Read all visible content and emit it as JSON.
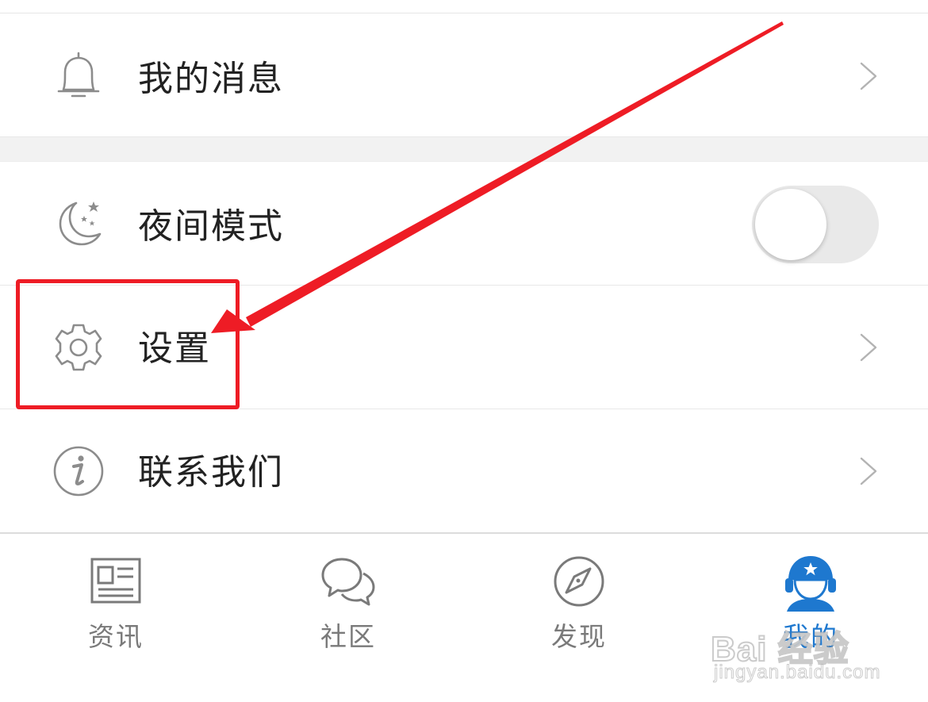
{
  "menu": {
    "messages_label": "我的消息",
    "night_mode_label": "夜间模式",
    "night_mode_on": false,
    "settings_label": "设置",
    "contact_label": "联系我们"
  },
  "tabs": [
    {
      "label": "资讯",
      "icon": "news-icon",
      "active": false
    },
    {
      "label": "社区",
      "icon": "chat-bubbles-icon",
      "active": false
    },
    {
      "label": "发现",
      "icon": "compass-icon",
      "active": false
    },
    {
      "label": "我的",
      "icon": "avatar-helmet-icon",
      "active": true
    }
  ],
  "colors": {
    "accent": "#1e78cf",
    "annotation_red": "#ee1c25",
    "icon_gray": "#8c8c8c",
    "label_gray": "#7a7a7a"
  },
  "watermark": {
    "brand": "Bai 经验",
    "url": "jingyan.baidu.com"
  }
}
